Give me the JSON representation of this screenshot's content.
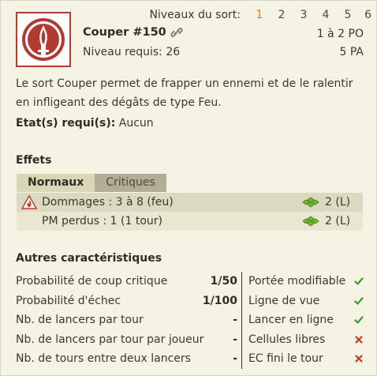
{
  "levels": {
    "label": "Niveaux du sort:",
    "items": [
      "1",
      "2",
      "3",
      "4",
      "5",
      "6"
    ],
    "active_index": 0
  },
  "spell": {
    "icon": "sword-fire-emblem-icon",
    "name": "Couper #150",
    "level_required": "Niveau requis: 26",
    "range": "1 à 2 PO",
    "ap_cost": "5 PA"
  },
  "description": "Le sort Couper permet de frapper un ennemi et de le ralentir en infligeant des dégâts de type Feu.",
  "requirements": {
    "label": "Etat(s) requi(s):",
    "value": "Aucun"
  },
  "effects": {
    "title": "Effets",
    "tabs": [
      {
        "label": "Normaux",
        "active": true
      },
      {
        "label": "Critiques",
        "active": false
      }
    ],
    "rows": [
      {
        "icon": "fire-icon",
        "text": "Dommages : 3 à 8 (feu)",
        "zone_icon": "cross-zone-icon",
        "duration": "2 (L)"
      },
      {
        "icon": "",
        "text": "PM perdus : 1 (1 tour)",
        "zone_icon": "cross-zone-icon",
        "duration": "2 (L)"
      }
    ]
  },
  "other": {
    "title": "Autres caractéristiques",
    "left": [
      {
        "label": "Probabilité de coup critique",
        "value": "1/50"
      },
      {
        "label": "Probabilité d'échec",
        "value": "1/100"
      },
      {
        "label": "Nb. de lancers par tour",
        "value": "-"
      },
      {
        "label": "Nb. de lancers par tour par joueur",
        "value": "-"
      },
      {
        "label": "Nb. de tours entre deux lancers",
        "value": "-"
      }
    ],
    "right": [
      {
        "label": "Portée modifiable",
        "ok": true
      },
      {
        "label": "Ligne de vue",
        "ok": true
      },
      {
        "label": "Lancer en ligne",
        "ok": true
      },
      {
        "label": "Cellules libres",
        "ok": false
      },
      {
        "label": "EC fini le tour",
        "ok": false
      }
    ]
  },
  "colors": {
    "background": "#f5f3e4",
    "accent_orange": "#e07a2c",
    "icon_red": "#b13a33",
    "check_green": "#3a9a2a",
    "cross_red": "#c0392b",
    "zone_green": "#6fbf2a"
  }
}
